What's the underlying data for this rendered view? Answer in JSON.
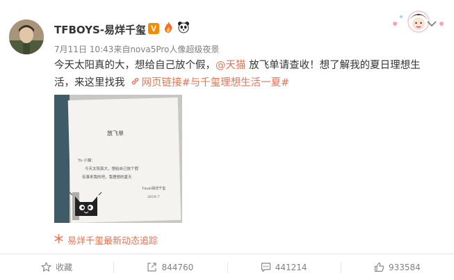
{
  "post": {
    "username": "TFBOYS-易烊千玺",
    "verified_badge": "V",
    "timestamp": "7月11日 10:43",
    "source": "来自nova5Pro人像超级夜景",
    "text_part1": "今天太阳真的大，想给自己放个假，",
    "mention": "@天猫",
    "text_part2": " 放飞单请查收！想了解我的夏日理想生活，来这里找我",
    "link_label": "网页链接",
    "topic": "#与千玺理想生活一夏#",
    "tracker_label": "易烊千玺最新动态追踪"
  },
  "note": {
    "title": "放飞单",
    "line1": "To 小猫：",
    "line2": "今天太阳真大，想给自己放个假",
    "line3": "有事来我的吧，我理想的夏天",
    "sign": "Tmall易烊千玺",
    "date": "2019.7"
  },
  "actions": {
    "favorite_label": "收藏",
    "repost_count": "844760",
    "comment_count": "441214",
    "like_count": "933584"
  },
  "icons": {
    "verified": "verified-v-badge",
    "fire": "fire-icon",
    "panda": "panda-icon",
    "link": "link-icon",
    "tracker": "snowflake-icon",
    "favorite": "star-icon",
    "repost": "share-box-icon",
    "comment": "comment-icon",
    "like": "thumbs-up-icon",
    "menu": "chevron-down-icon"
  },
  "colors": {
    "accent": "#eb7350",
    "text": "#333333",
    "meta": "#808080",
    "verified": "#f28c00"
  }
}
